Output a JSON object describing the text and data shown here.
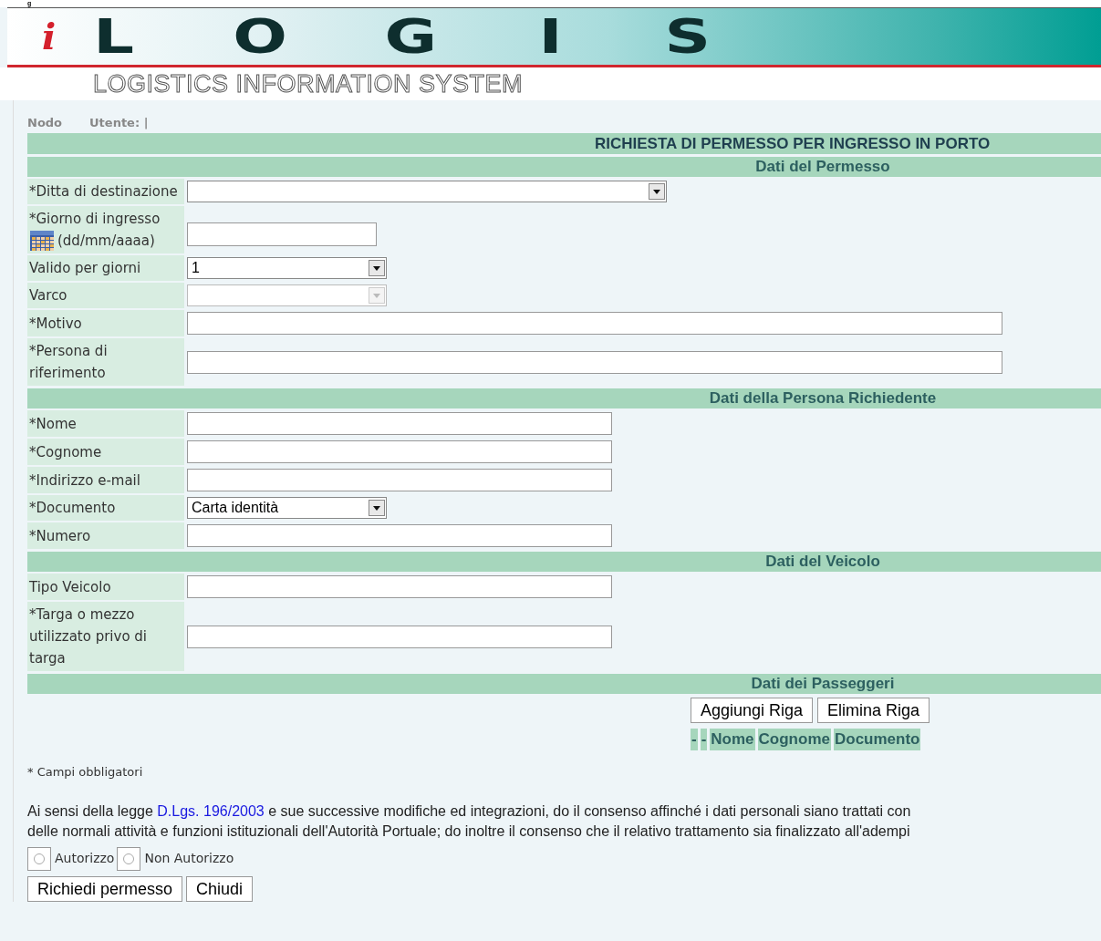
{
  "corner_text": "g",
  "logo": {
    "mark": "i",
    "letters": [
      "L",
      "O",
      "G",
      "I",
      "S"
    ],
    "subtitle": "LOGISTICS INFORMATION SYSTEM"
  },
  "user_bar": {
    "node": "Nodo",
    "user": "Utente: |"
  },
  "title": "RICHIESTA DI PERMESSO PER INGRESSO IN PORTO",
  "sections": [
    {
      "heading": "Dati del Permesso",
      "rows": [
        {
          "kind": "select",
          "label": "*Ditta di destinazione",
          "value": "",
          "disabled": false
        },
        {
          "kind": "date",
          "label": "*Giorno di ingresso",
          "hint": "(dd/mm/aaaa)"
        },
        {
          "kind": "select",
          "label": "Valido per giorni",
          "value": "1",
          "disabled": false
        },
        {
          "kind": "select",
          "label": "Varco",
          "value": "",
          "disabled": true
        },
        {
          "kind": "input",
          "label": "*Motivo"
        },
        {
          "kind": "input",
          "label": "*Persona di riferimento"
        }
      ]
    },
    {
      "heading": "Dati della Persona Richiedente",
      "rows": [
        {
          "kind": "input",
          "label": "*Nome"
        },
        {
          "kind": "input",
          "label": "*Cognome"
        },
        {
          "kind": "input",
          "label": "*Indirizzo e-mail"
        },
        {
          "kind": "select",
          "label": "*Documento",
          "value": "Carta identità",
          "disabled": false
        },
        {
          "kind": "input",
          "label": "*Numero"
        }
      ]
    },
    {
      "heading": "Dati del Veicolo",
      "rows": [
        {
          "kind": "input",
          "label": "Tipo Veicolo"
        },
        {
          "kind": "input",
          "label": "*Targa o mezzo utilizzato privo di targa"
        }
      ]
    },
    {
      "heading": "Dati dei Passeggeri"
    }
  ],
  "passenger_buttons": [
    "Aggiungi Riga",
    "Elimina Riga"
  ],
  "passenger_columns": [
    "-",
    "-",
    "Nome",
    "Cognome",
    "Documento"
  ],
  "required_note": "* Campi obbligatori",
  "consent": {
    "before": "Ai sensi della legge ",
    "link": "D.Lgs. 196/2003",
    "after": " e sue successive modifiche ed integrazioni, do il consenso affinché i dati personali siano trattati con",
    "line2": "delle normali attività e funzioni istituzionali dell'Autorità Portuale; do inoltre il consenso che il relativo trattamento sia finalizzato all'adempi"
  },
  "consent_options": [
    {
      "label": "Autorizzo",
      "selected": false
    },
    {
      "label": "Non Autorizzo",
      "selected": false
    }
  ],
  "buttons": [
    "Richiedi permesso",
    "Chiudi"
  ]
}
